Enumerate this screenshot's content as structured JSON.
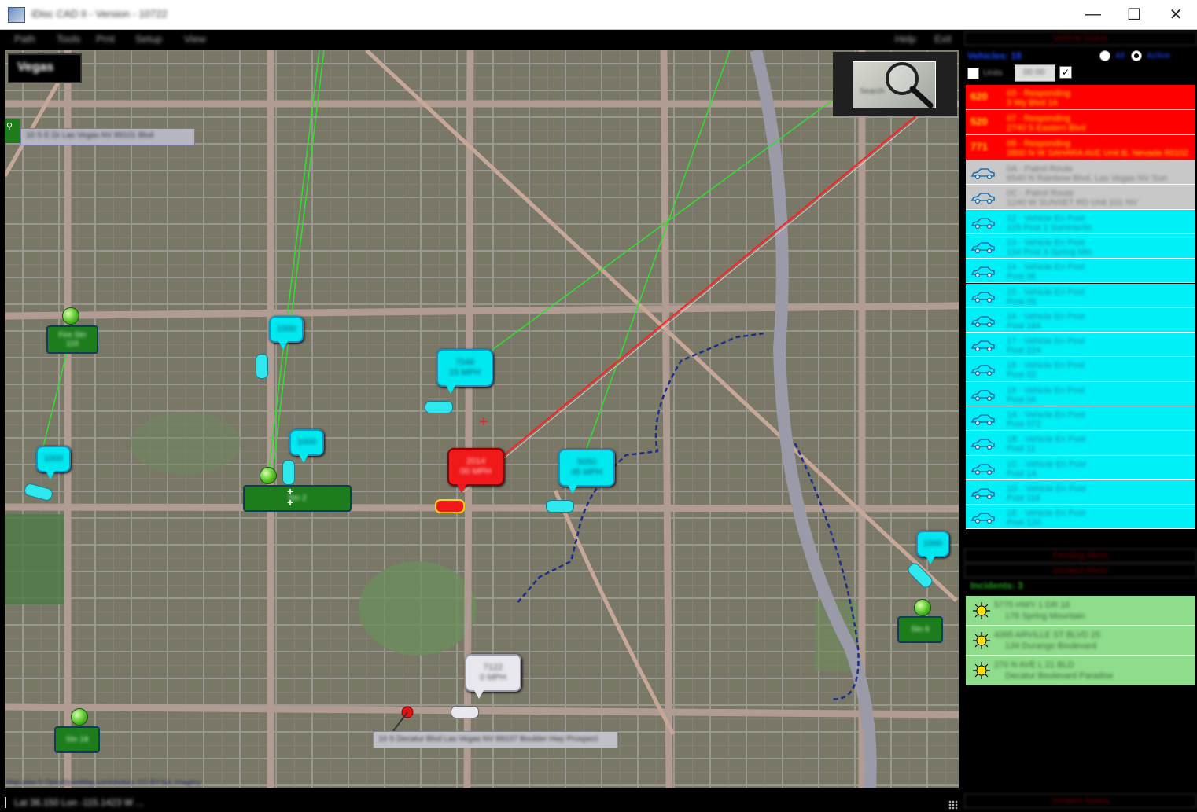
{
  "window": {
    "title": "iDisc CAD II - Version - 10722",
    "minimize_glyph": "—",
    "maximize_glyph": "☐",
    "close_glyph": "✕"
  },
  "menu": {
    "items": [
      "Path",
      "Tools",
      "Prnt",
      "Setup",
      "View"
    ],
    "right_items": [
      "Help",
      "Exit"
    ]
  },
  "map": {
    "location_label": "Vegas",
    "search_text": "Search",
    "search_box_value": "10 S E Dr Las Vegas NV 89101 Blvd",
    "address_bar_text": "10 S Decatur Blvd Las Vegas NV 89107 Boulder Hwy Prospect",
    "attribution": "Map data © OpenStreetMap contributors, CC-BY-SA, Imagery",
    "bubbles": [
      {
        "id": "b1",
        "text": "1000",
        "color": "cyan"
      },
      {
        "id": "b2",
        "text": "1000",
        "color": "cyan"
      },
      {
        "id": "b3",
        "text": "1000",
        "color": "cyan"
      },
      {
        "id": "b4",
        "text": "7046\n15 MPH",
        "color": "cyan"
      },
      {
        "id": "b5",
        "text": "2014\n00 MPH",
        "color": "red"
      },
      {
        "id": "b6",
        "text": "5050\n45 MPH",
        "color": "cyan"
      },
      {
        "id": "b7",
        "text": "1000",
        "color": "cyan"
      },
      {
        "id": "b8",
        "text": "7122\n0 MPH",
        "color": "white"
      }
    ],
    "stations": [
      {
        "id": "s1",
        "text": "Fire Stn\n116"
      },
      {
        "id": "s2",
        "text": "Stn 2"
      },
      {
        "id": "s3",
        "text": "Stn 18"
      },
      {
        "id": "s4",
        "text": "Stn 6"
      },
      {
        "id": "s5",
        "text": "Stn 11"
      }
    ]
  },
  "status_bar": {
    "text": "Lat 36.150 Lon -115.1423 W ..."
  },
  "panel": {
    "header_top": "Vehicle Status",
    "vehicles_title": "Vehicles: 18",
    "radio1_label": "All",
    "radio2_label": "Active",
    "filter_label": "Units",
    "filter_value": "00 00",
    "vehicle_rows": [
      {
        "style": "red",
        "num": "620",
        "l1": "03 · Responding",
        "l2": "3 Wy Blvd 16"
      },
      {
        "style": "red",
        "num": "520",
        "l1": "07 · Responding",
        "l2": "2740 S Eastern Blvd"
      },
      {
        "style": "red",
        "num": "771",
        "l1": "09 · Responding",
        "l2": "3900 N W SAHARA AVE Unit B, Nevada 89102"
      },
      {
        "style": "grey",
        "l1": "0A · Patrol Route",
        "l2": "6540 N Rainbow Blvd, Las Vegas NV Sun"
      },
      {
        "style": "grey",
        "l1": "0C · Patrol Route",
        "l2": "1240 W SUNSET RD Unit 101 NV"
      },
      {
        "style": "cyan",
        "l1": "12 · Vehicle En Post",
        "l2": "125 Post 1 Summerlin"
      },
      {
        "style": "cyan",
        "l1": "13 · Vehicle En Post",
        "l2": "134 Post 3 Spring Mtn"
      },
      {
        "style": "cyan",
        "l1": "14 · Vehicle En Post",
        "l2": "Post 06"
      },
      {
        "style": "cyan",
        "l1": "15 · Vehicle En Post",
        "l2": "Post 09"
      },
      {
        "style": "cyan",
        "l1": "16 · Vehicle En Post",
        "l2": "Post 184"
      },
      {
        "style": "cyan",
        "l1": "17 · Vehicle En Post",
        "l2": "Post 224"
      },
      {
        "style": "cyan",
        "l1": "18 · Vehicle En Post",
        "l2": "Post 02"
      },
      {
        "style": "cyan",
        "l1": "19 · Vehicle En Post",
        "l2": "Post 04"
      },
      {
        "style": "cyan",
        "l1": "1A · Vehicle En Post",
        "l2": "Post 072"
      },
      {
        "style": "cyan",
        "l1": "1B · Vehicle En Post",
        "l2": "Post 11"
      },
      {
        "style": "cyan",
        "l1": "1C · Vehicle En Post",
        "l2": "Post 1A"
      },
      {
        "style": "cyan",
        "l1": "1D · Vehicle En Post",
        "l2": "Post 118"
      },
      {
        "style": "cyan",
        "l1": "1E · Vehicle En Post",
        "l2": "Post 120"
      }
    ],
    "header_mid1": "Pending Alerts",
    "header_mid2": "Incident Alerts",
    "incidents_title": "Incidents: 3",
    "incident_rows": [
      {
        "l1": "5775 HWY 1 DR 16",
        "l2": "176 Spring Mountain"
      },
      {
        "l1": "4395 ARVILLE ST BLVD 25",
        "l2": "134 Durango Boulevard"
      },
      {
        "l1": "270 N AVE L 21 BLD",
        "l2": "Decatur Boulevard Paradise"
      }
    ],
    "header_bottom": "Incident Status"
  }
}
